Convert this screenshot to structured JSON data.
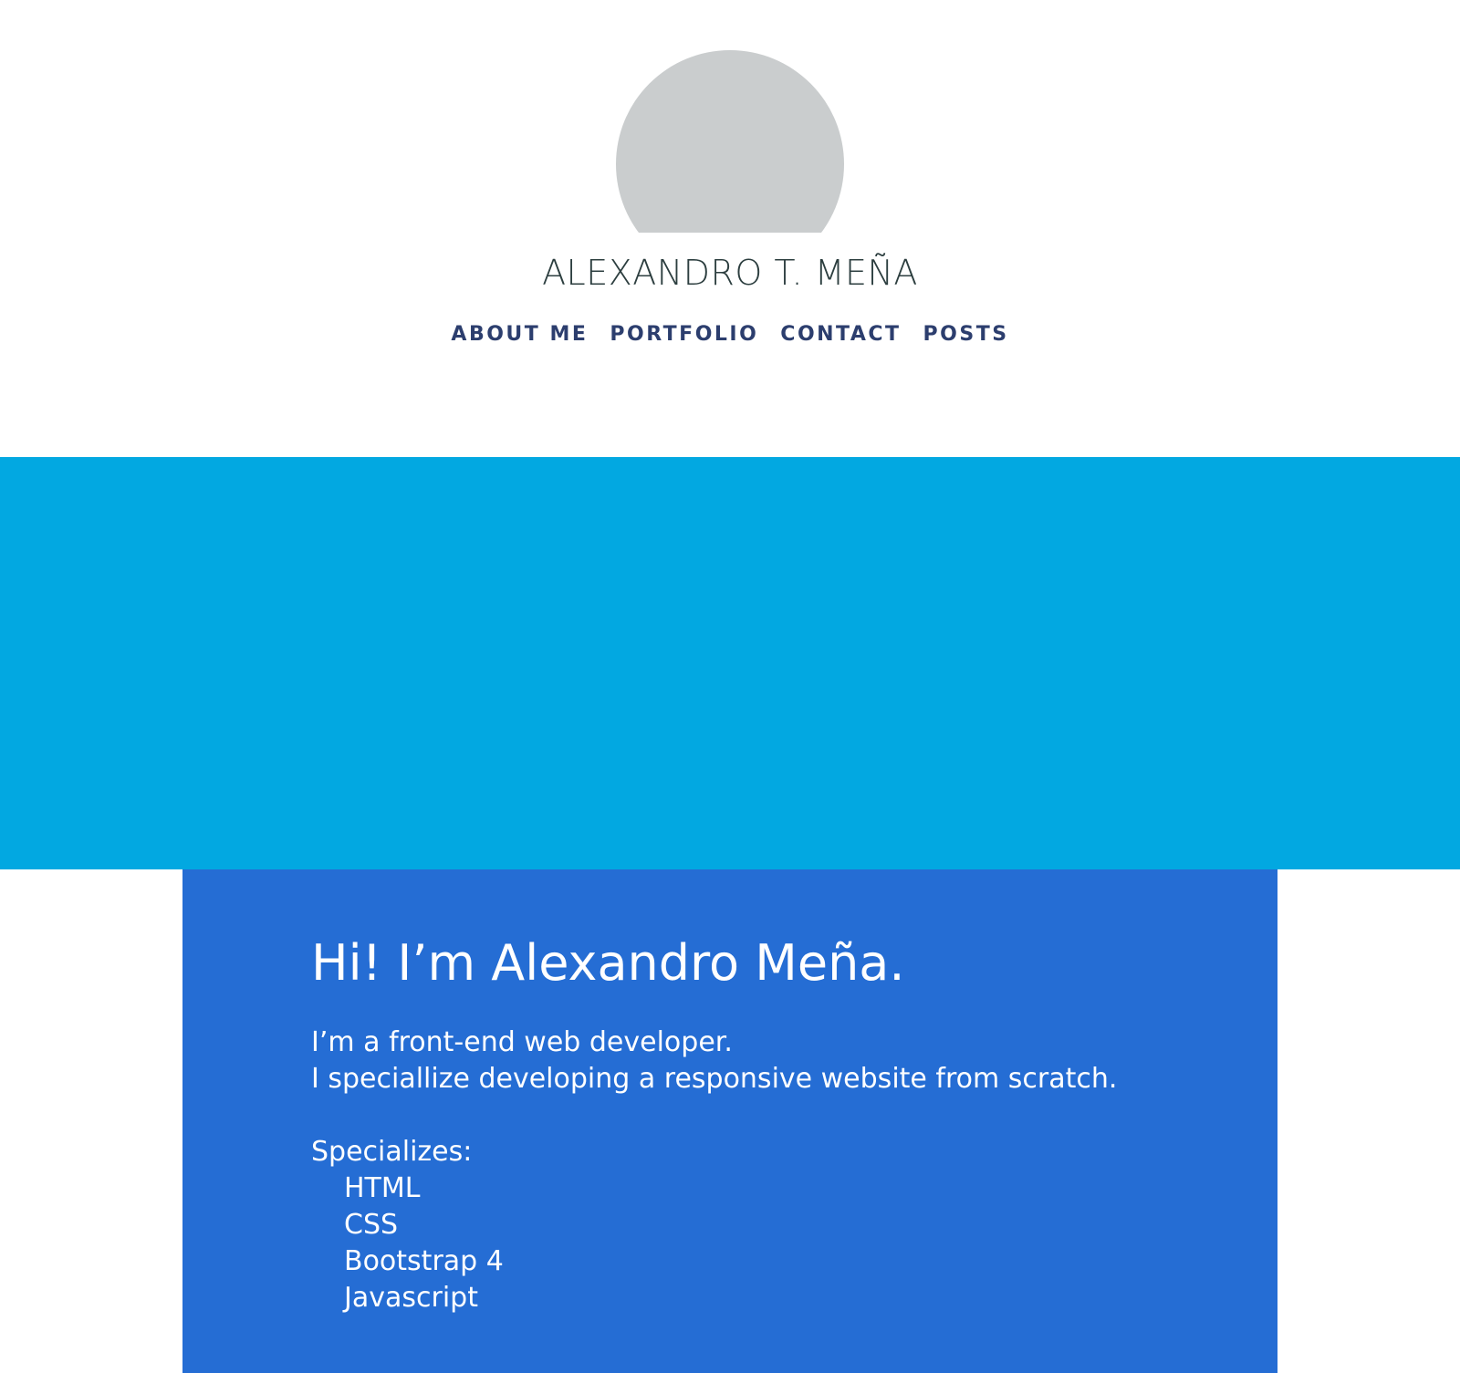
{
  "header": {
    "site_title": "ALEXANDRO T. MEÑA",
    "avatar_color": "#cacdce",
    "nav": [
      {
        "label": "ABOUT ME"
      },
      {
        "label": "PORTFOLIO"
      },
      {
        "label": "CONTACT"
      },
      {
        "label": "POSTS"
      }
    ]
  },
  "banner": {
    "color": "#02a8e1"
  },
  "about": {
    "background_color": "#256dd4",
    "heading": "Hi! I’m Alexandro Meña.",
    "intro_line_1": "I’m a front-end web developer.",
    "intro_line_2": "I speciallize developing a responsive website from scratch.",
    "specializes_label": "Specializes:",
    "skills": [
      "HTML",
      "CSS",
      "Bootstrap 4",
      "Javascript"
    ]
  }
}
